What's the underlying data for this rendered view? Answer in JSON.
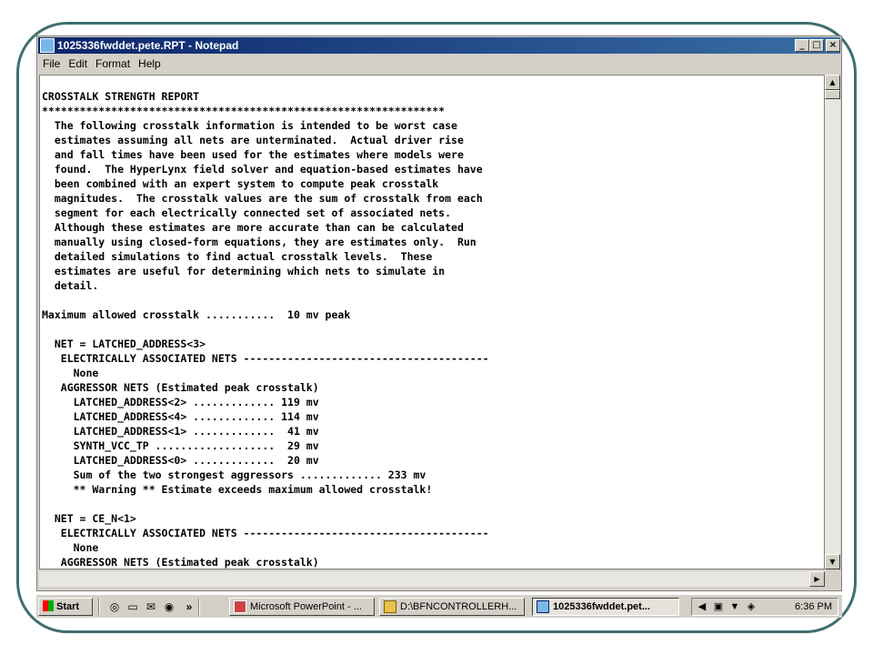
{
  "window": {
    "title": "1025336fwddet.pete.RPT - Notepad",
    "minimize": "_",
    "maximize": "□",
    "close": "×"
  },
  "menu": [
    "File",
    "Edit",
    "Format",
    "Help"
  ],
  "document": {
    "lines": [
      "CROSSTALK STRENGTH REPORT",
      "****************************************************************",
      "  The following crosstalk information is intended to be worst case",
      "  estimates assuming all nets are unterminated.  Actual driver rise",
      "  and fall times have been used for the estimates where models were",
      "  found.  The HyperLynx field solver and equation-based estimates have",
      "  been combined with an expert system to compute peak crosstalk",
      "  magnitudes.  The crosstalk values are the sum of crosstalk from each",
      "  segment for each electrically connected set of associated nets.",
      "  Although these estimates are more accurate than can be calculated",
      "  manually using closed-form equations, they are estimates only.  Run",
      "  detailed simulations to find actual crosstalk levels.  These",
      "  estimates are useful for determining which nets to simulate in",
      "  detail.",
      "",
      "Maximum allowed crosstalk ...........  10 mv peak",
      "",
      "  NET = LATCHED_ADDRESS<3>",
      "   ELECTRICALLY ASSOCIATED NETS ---------------------------------------",
      "     None",
      "   AGGRESSOR NETS (Estimated peak crosstalk)",
      "     LATCHED_ADDRESS<2> ............. 119 mv",
      "     LATCHED_ADDRESS<4> ............. 114 mv",
      "     LATCHED_ADDRESS<1> .............  41 mv",
      "     SYNTH_VCC_TP ...................  29 mv",
      "     LATCHED_ADDRESS<0> .............  20 mv",
      "     Sum of the two strongest aggressors ............. 233 mv",
      "     ** Warning ** Estimate exceeds maximum allowed crosstalk!",
      "",
      "  NET = CE_N<1>",
      "   ELECTRICALLY ASSOCIATED NETS ---------------------------------------",
      "     None",
      "   AGGRESSOR NETS (Estimated peak crosstalk)"
    ]
  },
  "taskbar": {
    "start": "Start",
    "quicklaunch_more": "»",
    "tasks": [
      {
        "label": "Microsoft PowerPoint - ...",
        "active": false
      },
      {
        "label": "D:\\BFNCONTROLLERH...",
        "active": false
      },
      {
        "label": "1025336fwddet.pet...",
        "active": true
      }
    ],
    "clock": "6:36 PM"
  },
  "colors": {
    "titlebar": "#0a246a",
    "chrome": "#d4d0c8",
    "frame": "#3f6f6f"
  }
}
